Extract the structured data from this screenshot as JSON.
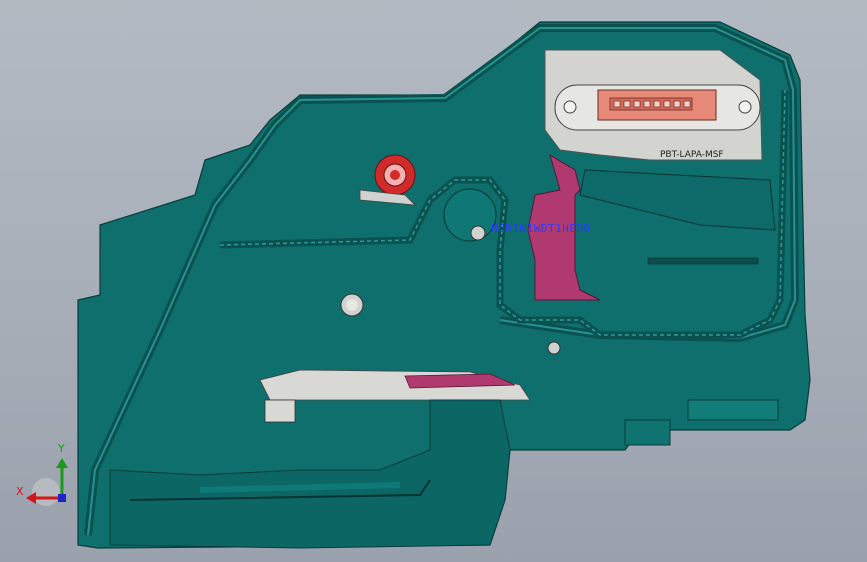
{
  "viewport": {
    "background_top": "#b3bac3",
    "background_bottom": "#9aa1ac"
  },
  "model": {
    "body_color": "#0e6f6d",
    "edge_color": "#063d3b",
    "highlight_color": "#b0465f",
    "overlay_text": "NCD1W1WDT1HEDD",
    "connector_label": "PBT-LAPA-MSF"
  },
  "triad": {
    "x_label": "X",
    "y_label": "Y",
    "x_color": "#d01818",
    "y_color": "#1a9a1a",
    "z_color": "#2222cc"
  }
}
